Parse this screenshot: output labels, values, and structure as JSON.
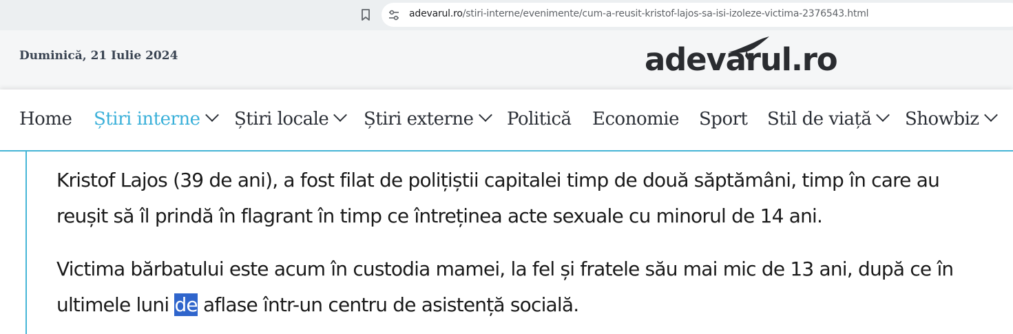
{
  "browser": {
    "url_host": "adevarul.ro",
    "url_path": "/stiri-interne/evenimente/cum-a-reusit-kristof-lajos-sa-isi-izoleze-victima-2376543.html",
    "bookmark_icon": "bookmark-icon",
    "site_info_icon": "tune-icon"
  },
  "header": {
    "date": "Duminică, 21 Iulie 2024",
    "logo": "adevarul.ro",
    "background": "#f5f6f7"
  },
  "nav": {
    "items": [
      {
        "label": "Home"
      },
      {
        "label": "Știri interne",
        "active": true,
        "dropdown": true
      },
      {
        "label": "Știri locale",
        "dropdown": true
      },
      {
        "label": "Știri externe",
        "dropdown": true
      },
      {
        "label": "Politică"
      },
      {
        "label": "Economie"
      },
      {
        "label": "Sport"
      },
      {
        "label": "Stil de viață",
        "dropdown": true
      },
      {
        "label": "Showbiz",
        "dropdown": true
      }
    ],
    "accent": "#45b5d6"
  },
  "article": {
    "p1": "Kristof Lajos (39 de ani), a fost filat de polițiștii capitalei timp de două săptămâni, timp în care au reușit să îl prindă în flagrant în timp ce întreținea acte sexuale cu minorul de 14 ani.",
    "p2_before": "Victima bărbatului este acum în custodia mamei, la fel și fratele său mai mic de 13 ani, după ce în ultimele luni ",
    "p2_selected": "de",
    "p2_after": " aflase într-un centru de asistență socială.",
    "selection_color": "#2f65cc"
  }
}
